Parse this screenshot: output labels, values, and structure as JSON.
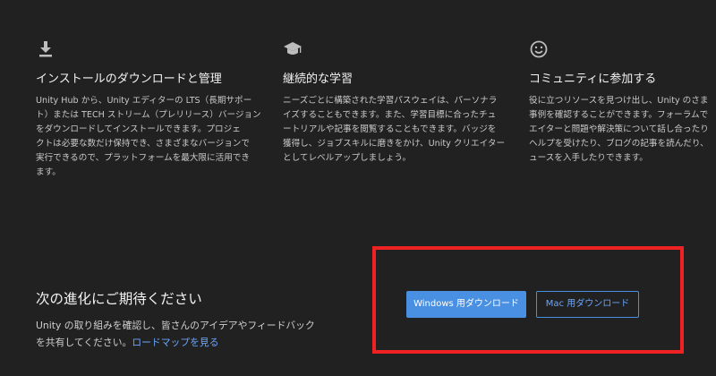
{
  "features": [
    {
      "icon": "download-icon",
      "title": "インストールのダウンロードと管理",
      "lines": [
        "Unity Hub から、Unity エディターの LTS（長期サポー",
        "ト）または TECH ストリーム（プレリリース）バージョン",
        "をダウンロードしてインストールできます。プロジェ",
        "クトは必要な数だけ保持でき、さまざまなバージョンで",
        "実行できるので、プラットフォームを最大限に活用でき",
        "ます。"
      ]
    },
    {
      "icon": "graduation-cap-icon",
      "title": "継続的な学習",
      "lines": [
        "ニーズごとに構築された学習パスウェイは、パーソナラ",
        "イズすることもできます。また、学習目標に合ったチュ",
        "ートリアルや記事を閲覧することもできます。バッジを",
        "獲得し、ジョブスキルに磨きをかけ、Unity クリエイター",
        "としてレベルアップしましょう。"
      ]
    },
    {
      "icon": "smiley-icon",
      "title": "コミュニティに参加する",
      "lines": [
        "役に立つリソースを見つけ出し、Unity のさま",
        "事例を確認することができます。フォーラムで",
        "エイターと問題や解決策について話し合ったり",
        "ヘルプを受けたり、ブログの記事を読んだり、",
        "ュースを入手したりできます。"
      ]
    }
  ],
  "roadmap": {
    "title": "次の進化にご期待ください",
    "text_line1": "Unity の取り組みを確認し、皆さんのアイデアやフィードバック",
    "text_line2": "を共有してください。",
    "link": "ロードマップを見る"
  },
  "downloads": {
    "windows_label": "Windows 用ダウンロード",
    "mac_label": "Mac 用ダウンロード"
  },
  "colors": {
    "background": "#212121",
    "accent": "#4a90e2",
    "link": "#6aa6ff",
    "highlight_border": "#ee2222"
  }
}
